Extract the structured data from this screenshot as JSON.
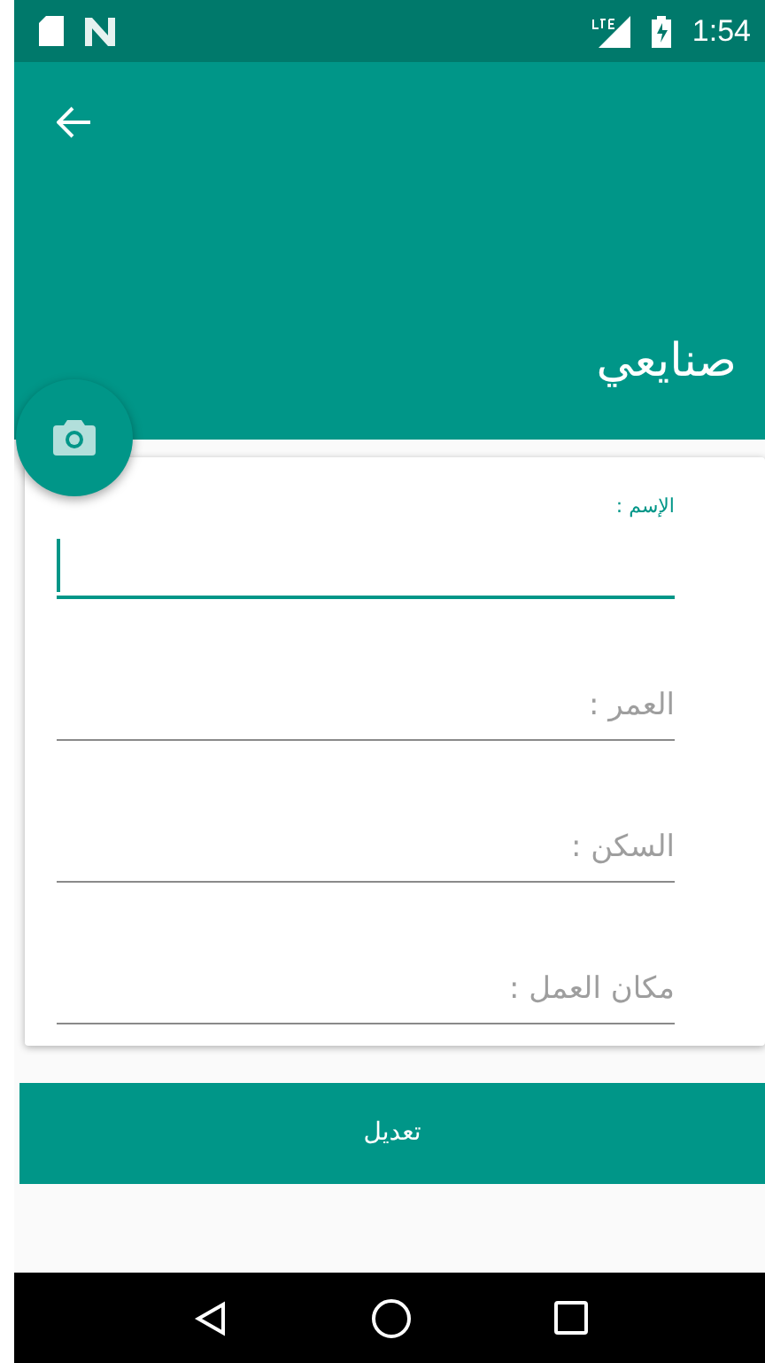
{
  "status_bar": {
    "time": "1:54"
  },
  "app_bar": {
    "title": "صنايعي"
  },
  "fields": [
    {
      "label": "الإسم :",
      "focused": true
    },
    {
      "label": "العمر :",
      "focused": false
    },
    {
      "label": "السكن :",
      "focused": false
    },
    {
      "label": "مكان العمل :",
      "focused": false
    }
  ],
  "button": {
    "label": "تعديل"
  }
}
